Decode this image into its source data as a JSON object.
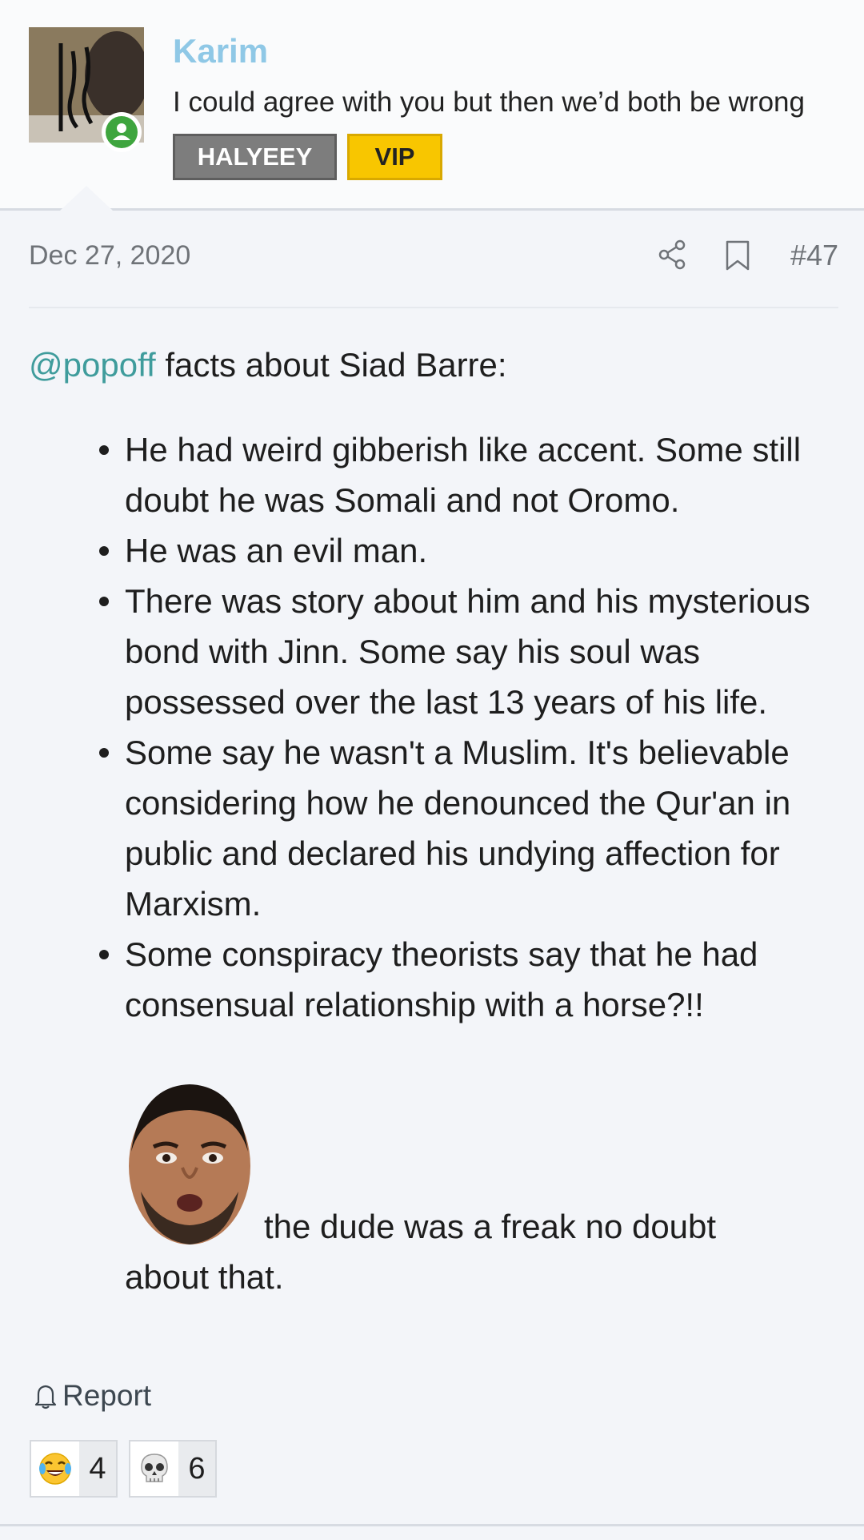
{
  "user": {
    "name": "Karim",
    "title": "I could agree with you but then we’d both be wrong",
    "badges": [
      "HALYEEY",
      "VIP"
    ]
  },
  "post": {
    "date": "Dec 27, 2020",
    "number": "#47",
    "mention": "@popoff",
    "intro": " facts about Siad Barre:",
    "facts": [
      "He had weird gibberish like accent. Some still doubt he was Somali and not Oromo.",
      "He was an evil man.",
      "There was story about him and his mysterious bond with Jinn. Some say his soul was possessed over the last 13 years of his life.",
      "Some say he wasn't a Muslim. It's believable considering how he denounced the Qur'an in public and declared his undying affection for Marxism.",
      "Some conspiracy theorists say that he had consensual relationship with a horse?!!"
    ],
    "tail_line1": "the dude was a freak no doubt",
    "tail_line2": "about that."
  },
  "actions": {
    "report": "Report"
  },
  "reactions": [
    {
      "icon": "laughing-crying-emoji",
      "count": "4"
    },
    {
      "icon": "skull-emoji",
      "count": "6"
    }
  ],
  "colors": {
    "username": "#8fc8e6",
    "mention": "#3f9c9c",
    "vip_badge": "#f8c600",
    "user_badge": "#7d7d7d",
    "online": "#3ea53e"
  }
}
